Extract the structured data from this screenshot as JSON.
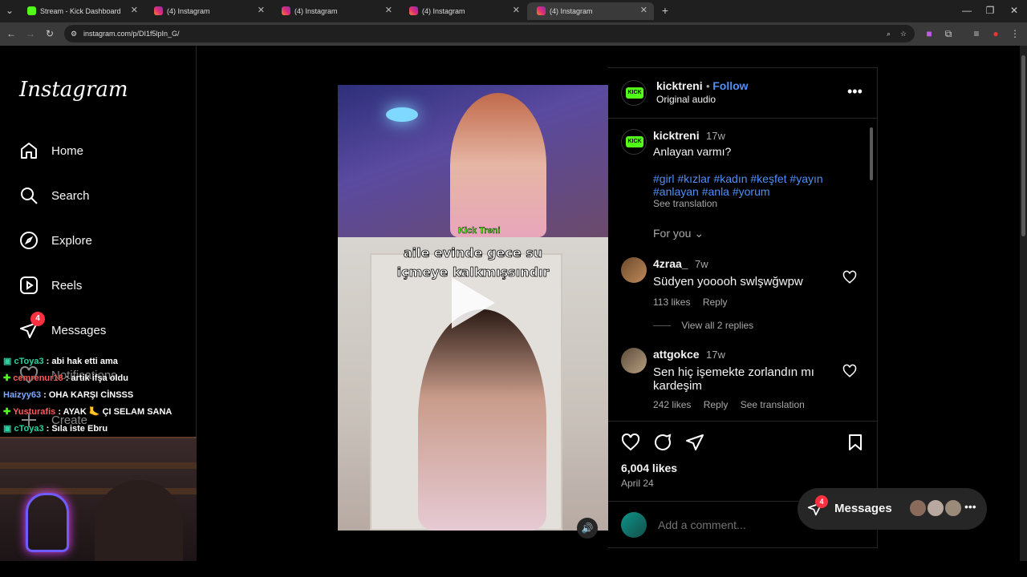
{
  "browser": {
    "tabs": [
      {
        "title": "Stream - Kick Dashboard",
        "color": "#53fc18"
      },
      {
        "title": "(4) Instagram",
        "color": "#e1306c"
      },
      {
        "title": "(4) Instagram",
        "color": "#e1306c"
      },
      {
        "title": "(4) Instagram",
        "color": "#e1306c"
      },
      {
        "title": "(4) Instagram",
        "color": "#e1306c"
      }
    ],
    "url": "instagram.com/p/DI1f5lpIn_G/"
  },
  "sidebar": {
    "logo": "Instagram",
    "items": [
      {
        "label": "Home",
        "icon": "home-icon"
      },
      {
        "label": "Search",
        "icon": "search-icon"
      },
      {
        "label": "Explore",
        "icon": "compass-icon"
      },
      {
        "label": "Reels",
        "icon": "reels-icon"
      },
      {
        "label": "Messages",
        "icon": "messages-icon",
        "badge": "4"
      },
      {
        "label": "Notifications",
        "icon": "heart-icon"
      },
      {
        "label": "Create",
        "icon": "plus-icon"
      }
    ]
  },
  "stream_chat": [
    {
      "user": "cToya3",
      "text": "abi hak etti ama",
      "color": "#2fd0a0"
    },
    {
      "user": "cemrenur18",
      "text": "artik ifşa oldu",
      "color": "#ff5a5a"
    },
    {
      "user": "Haizyy63",
      "text": "OHA KARŞI CİNSSS",
      "color": "#7aa7ff"
    },
    {
      "user": "Yusturafis",
      "text": "AYAK 🦶 ÇI SELAM SANA",
      "color": "#ff5a5a"
    },
    {
      "user": "cToya3",
      "text": "Sıla iste Ebru",
      "color": "#2fd0a0"
    }
  ],
  "video": {
    "overlay_line1": "aile evinde gece su",
    "overlay_line2": "içmeye kalkmışsındır",
    "watermark": "Kick Treni"
  },
  "post": {
    "author": "kicktreni",
    "follow_label": "Follow",
    "audio": "Original audio",
    "caption_time": "17w",
    "caption_text": "Anlayan varmı?",
    "hashtags_line1": "#girl #kızlar #kadın #keşfet #yayın",
    "hashtags_line2": "#anlayan #anla #yorum",
    "see_translation": "See translation",
    "for_you": "For you",
    "comments": [
      {
        "user": "4zraa_",
        "time": "7w",
        "text": "Südyen yooooh swlşwğwpw",
        "likes": "113 likes",
        "reply": "Reply",
        "view_replies": "View all 2 replies"
      },
      {
        "user": "attgokce",
        "time": "17w",
        "text": "Sen hiç işemekte zorlandın mı kardeşim",
        "likes": "242 likes",
        "reply": "Reply",
        "translate": "See translation"
      }
    ],
    "likes": "6,004 likes",
    "date": "April 24",
    "add_comment_placeholder": "Add a comment..."
  },
  "messages_pill": {
    "label": "Messages",
    "badge": "4"
  }
}
